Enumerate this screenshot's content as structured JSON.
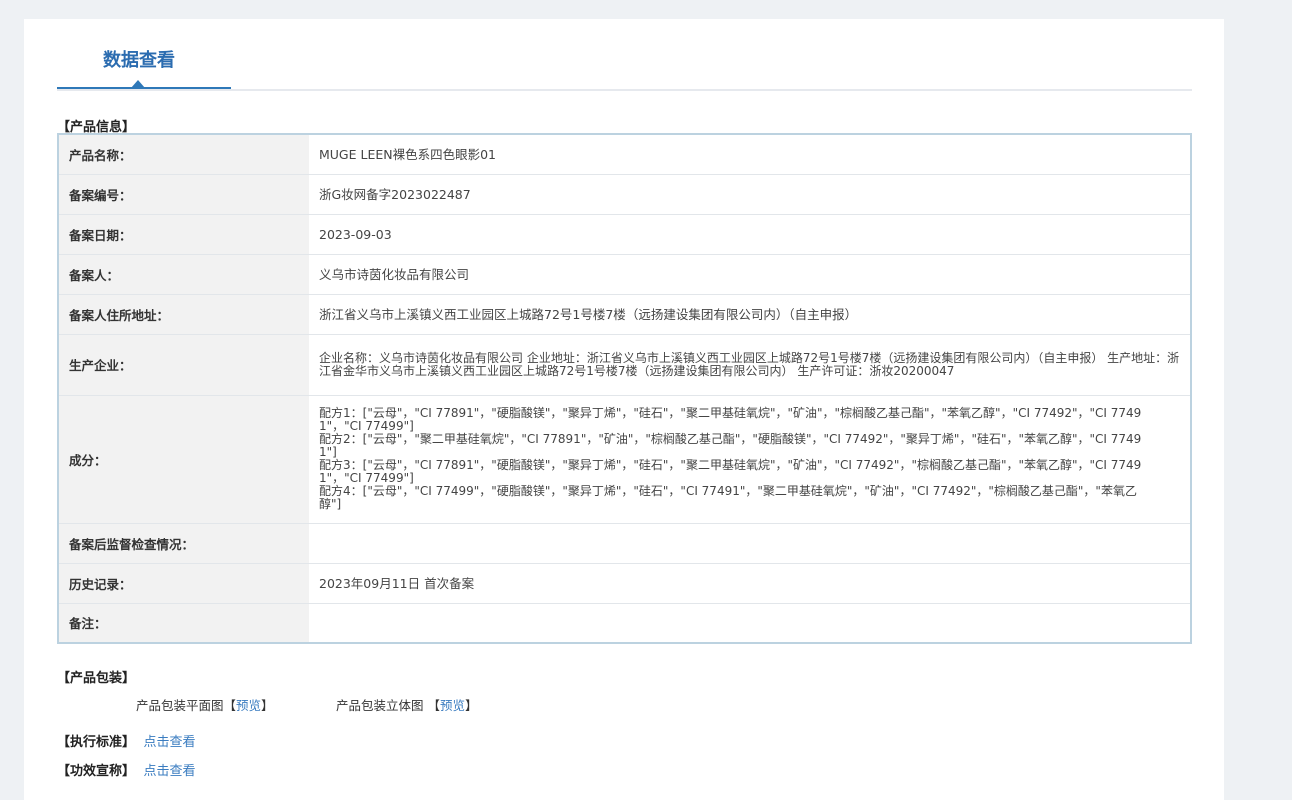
{
  "tab": {
    "label": "数据查看"
  },
  "product_info": {
    "title": "【产品信息】",
    "rows": [
      {
        "label": "产品名称：",
        "value": "MUGE LEEN裸色系四色眼影01"
      },
      {
        "label": "备案编号：",
        "value": "浙G妆网备字2023022487"
      },
      {
        "label": "备案日期：",
        "value": "2023-09-03"
      },
      {
        "label": "备案人：",
        "value": "义乌市诗茵化妆品有限公司"
      },
      {
        "label": "备案人住所地址：",
        "value": "浙江省义乌市上溪镇义西工业园区上城路72号1号楼7楼（远扬建设集团有限公司内）（自主申报）"
      },
      {
        "label": "生产企业：",
        "value": "企业名称：义乌市诗茵化妆品有限公司 企业地址：浙江省义乌市上溪镇义西工业园区上城路72号1号楼7楼（远扬建设集团有限公司内）（自主申报） 生产地址：浙江省金华市义乌市上溪镇义西工业园区上城路72号1号楼7楼（远扬建设集团有限公司内） 生产许可证：浙妆20200047"
      },
      {
        "label": "成分：",
        "value": ""
      },
      {
        "label": "备案后监督检查情况：",
        "value": ""
      },
      {
        "label": "历史记录：",
        "value": "2023年09月11日 首次备案"
      },
      {
        "label": "备注：",
        "value": ""
      }
    ],
    "ingredients": [
      "配方1：[\"云母\"，\"CI 77891\"，\"硬脂酸镁\"，\"聚异丁烯\"，\"硅石\"，\"聚二甲基硅氧烷\"，\"矿油\"，\"棕榈酸乙基己酯\"，\"苯氧乙醇\"，\"CI 77492\"，\"CI 77491\"，\"CI 77499\"]",
      "配方2：[\"云母\"，\"聚二甲基硅氧烷\"，\"CI 77891\"，\"矿油\"，\"棕榈酸乙基己酯\"，\"硬脂酸镁\"，\"CI 77492\"，\"聚异丁烯\"，\"硅石\"，\"苯氧乙醇\"，\"CI 77491\"]",
      "配方3：[\"云母\"，\"CI 77891\"，\"硬脂酸镁\"，\"聚异丁烯\"，\"硅石\"，\"聚二甲基硅氧烷\"，\"矿油\"，\"CI 77492\"，\"棕榈酸乙基己酯\"，\"苯氧乙醇\"，\"CI 77491\"，\"CI 77499\"]",
      "配方4：[\"云母\"，\"CI 77499\"，\"硬脂酸镁\"，\"聚异丁烯\"，\"硅石\"，\"CI 77491\"，\"聚二甲基硅氧烷\"，\"矿油\"，\"CI 77492\"，\"棕榈酸乙基己酯\"，\"苯氧乙醇\"]"
    ]
  },
  "packaging": {
    "title": "【产品包装】",
    "flat_label": "产品包装平面图",
    "flat_link": "预览",
    "solid_label": "产品包装立体图",
    "solid_link": "预览",
    "bracket_open": "【",
    "bracket_close": "】"
  },
  "standard": {
    "title": "【执行标准】",
    "link": "点击查看"
  },
  "efficacy": {
    "title": "【功效宣称】",
    "link": "点击查看"
  }
}
